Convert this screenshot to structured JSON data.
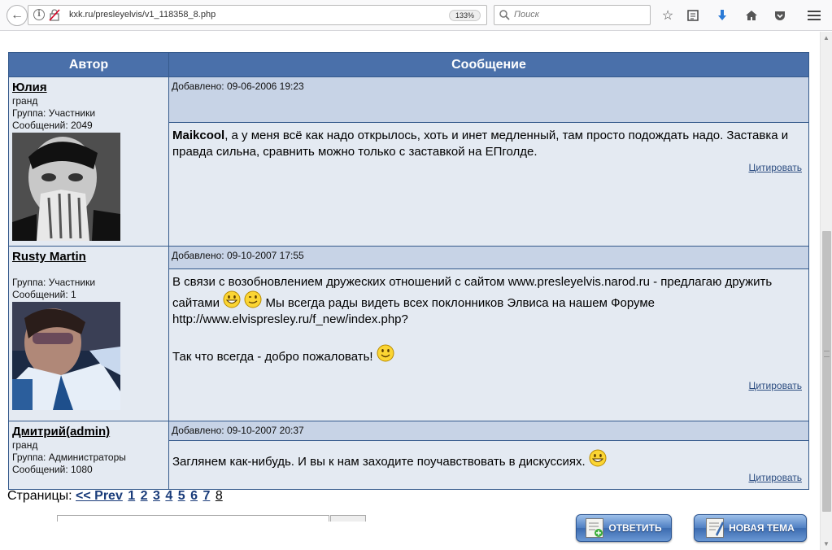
{
  "browser": {
    "url": "kxk.ru/presleyelvis/v1_118358_8.php",
    "zoom": "133%",
    "search_placeholder": "Поиск"
  },
  "table": {
    "col_author": "Автор",
    "col_message": "Сообщение"
  },
  "posts": [
    {
      "author": "Юлия",
      "rank": "гранд",
      "group": "Группа: Участники",
      "count": "Сообщений: 2049",
      "added": "Добавлено: 09-06-2006 19:23",
      "bold_start": "Maikcool",
      "text": ", а у меня всё как надо открылось, хоть и инет медленный, там просто подождать надо. Заставка и правда сильна, сравнить можно только с заставкой на ЕПголде.",
      "quote": "Цитировать"
    },
    {
      "author": "Rusty Martin",
      "rank": "",
      "group": "Группа: Участники",
      "count": "Сообщений: 1",
      "added": "Добавлено: 09-10-2007 17:55",
      "text1": "В связи с возобновлением дружеских отношений с сайтом www.presleyelvis.narod.ru - предлагаю дружить сайтами",
      "text2": "Мы всегда рады видеть всех поклонников Элвиса на нашем Форуме http://www.elvispresley.ru/f_new/index.php?",
      "text3": "Так что всегда - добро пожаловать!",
      "quote": "Цитировать"
    },
    {
      "author": "Дмитрий(admin)",
      "rank": "гранд",
      "group": "Группа: Администраторы",
      "count": "Сообщений: 1080",
      "added": "Добавлено: 09-10-2007 20:37",
      "text": "Заглянем как-нибудь. И вы к нам заходите поучавствовать в дискуссиях.",
      "quote": "Цитировать"
    }
  ],
  "pagination": {
    "label": "Страницы:",
    "prev": "<< Prev",
    "pages": [
      "1",
      "2",
      "3",
      "4",
      "5",
      "6",
      "7",
      "8"
    ]
  },
  "buttons": {
    "reply": "ОТВЕТИТЬ",
    "new_topic": "НОВАЯ ТЕМА"
  },
  "colors": {
    "header_bg": "#4a70aa",
    "post_bg": "#e4eaf2",
    "head_bg": "#c7d3e6"
  }
}
